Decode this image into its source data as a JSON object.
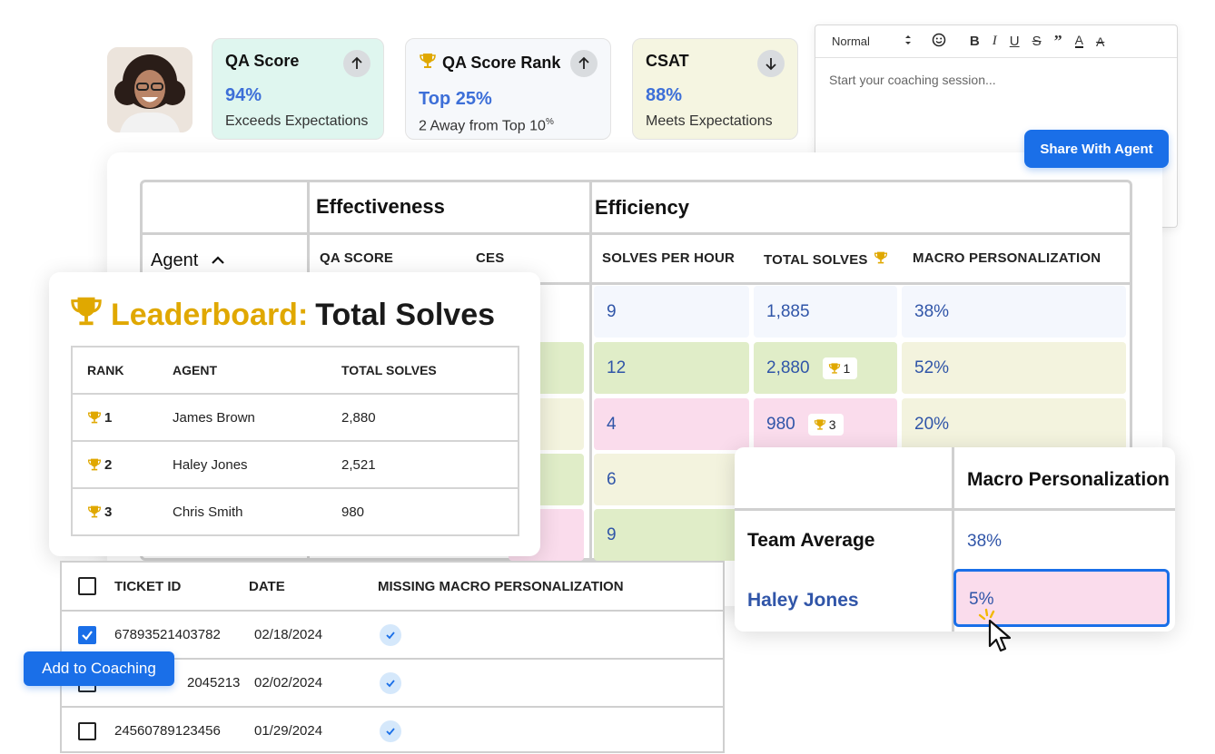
{
  "cards": [
    {
      "title": "QA Score",
      "value": "94%",
      "sub": "Exceeds Expectations",
      "trend": "up",
      "bg": "#dff6ef"
    },
    {
      "title": "QA Score Rank",
      "value": "Top 25%",
      "sub": "2 Away from Top 10",
      "sub_sup": "%",
      "trend": "up",
      "bg": "#f6f8fb"
    },
    {
      "title": "CSAT",
      "value": "88%",
      "sub": "Meets Expectations",
      "trend": "down",
      "bg": "#f5f5e1"
    }
  ],
  "editor": {
    "style_select": "Normal",
    "placeholder": "Start your coaching session...",
    "share_label": "Share With Agent"
  },
  "grid": {
    "groups": [
      "Effectiveness",
      "Efficiency"
    ],
    "agent_label": "Agent",
    "columns": [
      "QA SCORE",
      "CES",
      "SOLVES PER HOUR",
      "TOTAL SOLVES",
      "MACRO PERSONALIZATION"
    ],
    "rows": [
      {
        "sph": "9",
        "total": "1,885",
        "badge": "",
        "macro": "38%"
      },
      {
        "sph": "12",
        "total": "2,880",
        "badge": "1",
        "macro": "52%"
      },
      {
        "sph": "4",
        "total": "980",
        "badge": "3",
        "macro": "20%"
      },
      {
        "sph": "6",
        "total": "",
        "badge": "",
        "macro": ""
      },
      {
        "sph": "9",
        "total": "",
        "badge": "",
        "macro": ""
      }
    ]
  },
  "leaderboard": {
    "title_prefix": "Leaderboard:",
    "title_suffix": "Total Solves",
    "headers": [
      "RANK",
      "AGENT",
      "TOTAL SOLVES"
    ],
    "rows": [
      {
        "rank": "1",
        "agent": "James Brown",
        "total": "2,880"
      },
      {
        "rank": "2",
        "agent": "Haley Jones",
        "total": "2,521"
      },
      {
        "rank": "3",
        "agent": "Chris Smith",
        "total": "980"
      }
    ]
  },
  "tickets": {
    "headers": [
      "TICKET ID",
      "DATE",
      "MISSING MACRO PERSONALIZATION"
    ],
    "rows": [
      {
        "id": "67893521403782",
        "date": "02/18/2024",
        "checked": true
      },
      {
        "id": "2045213",
        "date": "02/02/2024",
        "checked": false
      },
      {
        "id": "24560789123456",
        "date": "01/29/2024",
        "checked": false
      }
    ],
    "add_label": "Add to Coaching"
  },
  "compare": {
    "header": "Macro Personalization",
    "team_label": "Team Average",
    "team_value": "38%",
    "agent_label": "Haley Jones",
    "agent_value": "5%"
  },
  "colors": {
    "accent": "#1a6fe8",
    "gold": "#e0a800",
    "value_blue": "#3055a8"
  }
}
